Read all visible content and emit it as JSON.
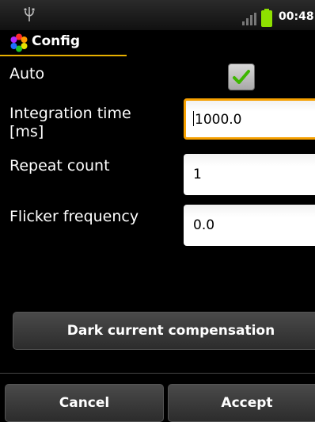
{
  "status_bar": {
    "time": "00:48",
    "icons": [
      "usb-icon",
      "signal-icon",
      "battery-icon"
    ],
    "battery_color": "#8ee000"
  },
  "header": {
    "title": "Config",
    "app_icon": "color-wheel-icon",
    "accent_color": "#e8b000"
  },
  "form": {
    "auto_label": "Auto",
    "auto_checked": true,
    "integration_label_line1": "Integration time",
    "integration_label_line2": "[ms]",
    "integration_value": "1000.0",
    "repeat_label": "Repeat count",
    "repeat_value": "1",
    "flicker_label": "Flicker frequency",
    "flicker_value": "0.0",
    "focus_color": "#f6a000"
  },
  "buttons": {
    "dark_current": "Dark current compensation",
    "cancel": "Cancel",
    "accept": "Accept"
  }
}
